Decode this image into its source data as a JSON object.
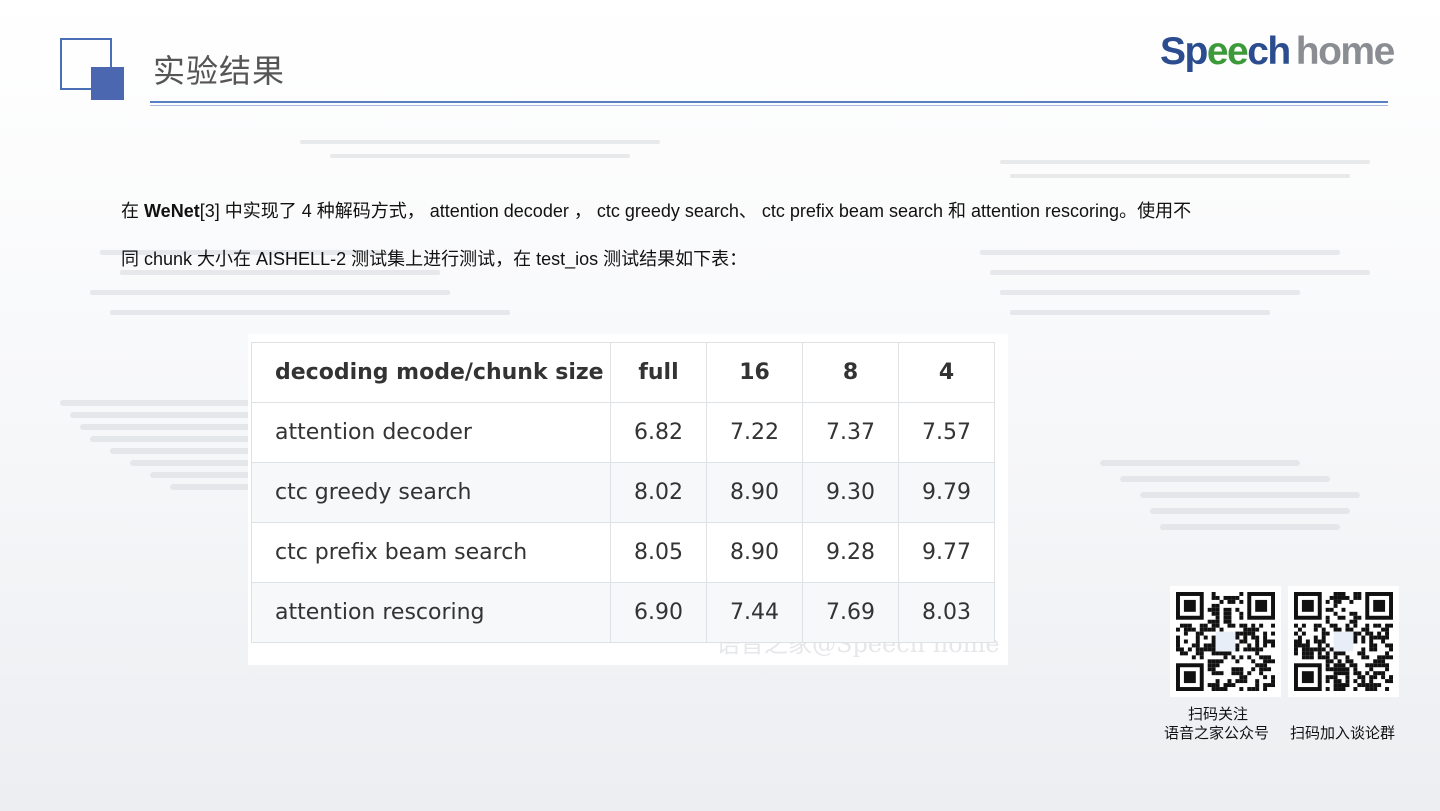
{
  "slide": {
    "title": "实验结果",
    "logo": {
      "part1": "Sp",
      "part2": "ee",
      "part3": "ch",
      "part4": "home"
    }
  },
  "paragraph": {
    "l1_a": "在 ",
    "l1_b": "WeNet",
    "l1_c": "[3] 中实现了 4 种解码方式， attention decoder ， ctc greedy search、 ctc prefix beam search 和 attention rescoring。使用不",
    "l2": "同 chunk 大小在 AISHELL-2 测试集上进行测试，在 test_ios 测试结果如下表："
  },
  "table": {
    "headers": [
      "decoding mode/chunk size",
      "full",
      "16",
      "8",
      "4"
    ],
    "rows": [
      [
        "attention decoder",
        "6.82",
        "7.22",
        "7.37",
        "7.57"
      ],
      [
        "ctc greedy search",
        "8.02",
        "8.90",
        "9.30",
        "9.79"
      ],
      [
        "ctc prefix beam search",
        "8.05",
        "8.90",
        "9.28",
        "9.77"
      ],
      [
        "attention rescoring",
        "6.90",
        "7.44",
        "7.69",
        "8.03"
      ]
    ],
    "watermark": "语音之家@Speech home"
  },
  "qr": {
    "label_follow": "扫码关注",
    "label_official": "语音之家公众号",
    "label_group": "扫码加入谈论群"
  }
}
